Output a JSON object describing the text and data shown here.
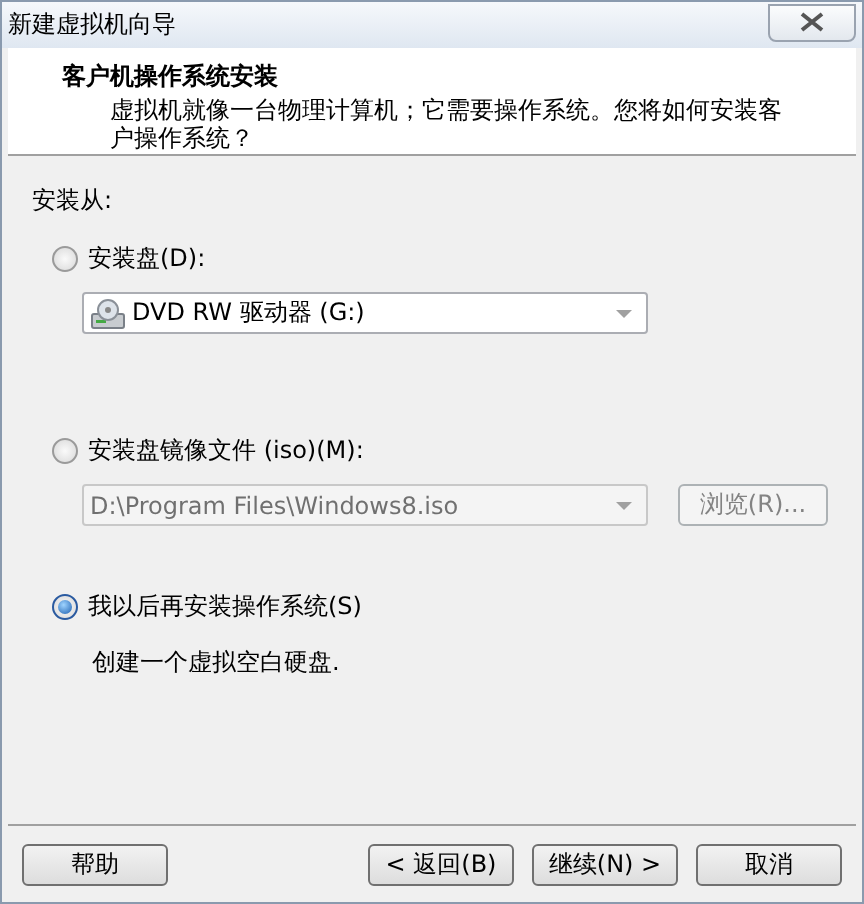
{
  "window": {
    "title": "新建虚拟机向导"
  },
  "header": {
    "title": "客户机操作系统安装",
    "description": "虚拟机就像一台物理计算机；它需要操作系统。您将如何安装客户操作系统？"
  },
  "install_from": {
    "label": "安装从:"
  },
  "options": [
    {
      "kind": "disc",
      "label": "安装盘(D):",
      "selected": false,
      "dropdown": {
        "value": "DVD RW 驱动器 (G:)",
        "disabled": false
      }
    },
    {
      "kind": "iso",
      "label": "安装盘镜像文件 (iso)(M):",
      "selected": false,
      "dropdown": {
        "value": "D:\\Program Files\\Windows8.iso",
        "disabled": true
      },
      "browse": {
        "label": "浏览(R)...",
        "disabled": true
      }
    },
    {
      "kind": "later",
      "label": "我以后再安装操作系统(S)",
      "selected": true,
      "description": "创建一个虚拟空白硬盘."
    }
  ],
  "buttons": [
    {
      "label": "帮助"
    },
    {
      "label": "< 返回(B)"
    },
    {
      "label": "继续(N) >"
    },
    {
      "label": "取消"
    }
  ]
}
